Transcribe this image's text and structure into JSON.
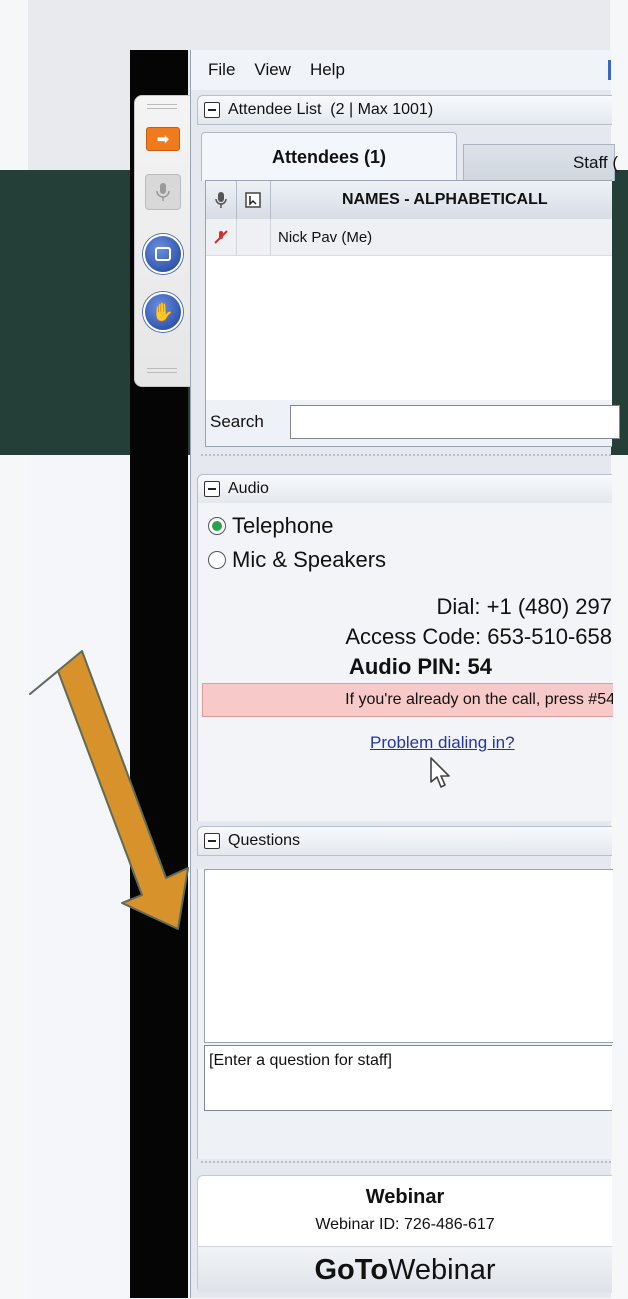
{
  "menubar": {
    "file": "File",
    "view": "View",
    "help": "Help"
  },
  "attendee_section": {
    "title": "Attendee List  (2 | Max 1001)"
  },
  "tabs": {
    "attendees": "Attendees (1)",
    "staff": "Staff ("
  },
  "list": {
    "header": "NAMES - ALPHABETICALL",
    "rows": [
      {
        "name": "Nick Pav (Me)"
      }
    ]
  },
  "search": {
    "label": "Search",
    "value": ""
  },
  "audio": {
    "title": "Audio",
    "options": [
      "Telephone",
      "Mic & Speakers"
    ],
    "selected": "Telephone",
    "dial_label": "Dial:",
    "dial_value": "+1 (480) 297",
    "access_label": "Access Code:",
    "access_value": "653-510-658",
    "pin_label": "Audio PIN:",
    "pin_value": "54",
    "warning": "If you're already on the call, press #54",
    "problem_link": "Problem dialing in?"
  },
  "questions": {
    "title": "Questions",
    "placeholder": "[Enter a question for staff]"
  },
  "footer": {
    "title": "Webinar",
    "webinar_id": "Webinar ID: 726-486-617",
    "brand_bold": "GoTo",
    "brand_light": "Webinar"
  },
  "colors": {
    "accent_arrow": "#d8922b",
    "warning_bg": "#f7c9c9",
    "link": "#2336a6",
    "rail_arrow": "#f07a1e"
  },
  "icons": [
    "arrow-right-icon",
    "microphone-icon",
    "screen-icon",
    "raise-hand-icon",
    "minus-icon",
    "mute-icon",
    "cursor-icon",
    "big-annotation-arrow"
  ]
}
